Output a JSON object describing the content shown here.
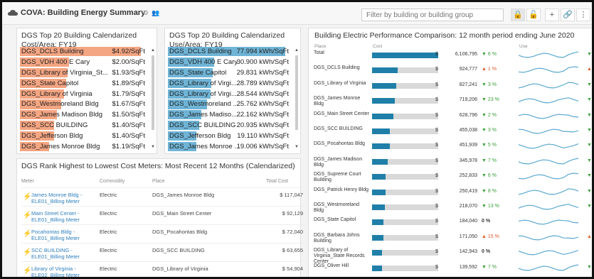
{
  "header": {
    "title": "COVA: Building Energy Summary",
    "filter_placeholder": "Filter by building or building group",
    "buttons": [
      "lock-icon",
      "lock-open-icon",
      "plus-icon",
      "link-icon",
      "more-icon"
    ]
  },
  "cost_area": {
    "title_line1": "DGS Top 20 Building Calendarized",
    "title_line2": "Cost/Area: FY19",
    "bar_color": "#f4a582",
    "max": 4.92,
    "rows": [
      {
        "name": "DGS_DCLS Building",
        "value": 4.92,
        "label": "$4.92/SqFt"
      },
      {
        "name": "DGS_VDH 400 E Cary",
        "value": 2.0,
        "label": "$2.00/SqFt"
      },
      {
        "name": "DGS_Library of Virginia_St...",
        "value": 1.93,
        "label": "$1.93/SqFt"
      },
      {
        "name": "DGS_State Capitol",
        "value": 1.89,
        "label": "$1.89/SqFt"
      },
      {
        "name": "DGS_Library of Virginia",
        "value": 1.79,
        "label": "$1.79/SqFt"
      },
      {
        "name": "DGS_Westmoreland Bldg",
        "value": 1.67,
        "label": "$1.67/SqFt"
      },
      {
        "name": "DGS_James Madison Bldg",
        "value": 1.5,
        "label": "$1.50/SqFt"
      },
      {
        "name": "DGS_SCC BUILDING",
        "value": 1.4,
        "label": "$1.40/SqFt"
      },
      {
        "name": "DGS_Jefferson Bldg",
        "value": 1.4,
        "label": "$1.40/SqFt"
      },
      {
        "name": "DGS_James Monroe Bldg",
        "value": 1.19,
        "label": "$1.19/SqFt"
      }
    ]
  },
  "use_area": {
    "title_line1": "DGS Top 20 Building Calendarized",
    "title_line2": "Use/Area: FY19",
    "bar_color": "#6fb4d6",
    "max": 77.994,
    "rows": [
      {
        "name": "DGS_DCLS Building",
        "value": 77.994,
        "label": "77.994 kWh/SqFt"
      },
      {
        "name": "DGS_VDH 400 E Cary",
        "value": 30.9,
        "label": "30.900 kWh/SqFt"
      },
      {
        "name": "DGS_State Capitol",
        "value": 29.831,
        "label": "29.831 kWh/SqFt"
      },
      {
        "name": "DGS_Library of Virgi...",
        "value": 28.789,
        "label": "28.789 kWh/SqFt"
      },
      {
        "name": "DGS_Library of Virgi...",
        "value": 28.544,
        "label": "28.544 kWh/SqFt"
      },
      {
        "name": "DGS_Westmoreland ...",
        "value": 25.762,
        "label": "25.762 kWh/SqFt"
      },
      {
        "name": "DGS_James Madiso...",
        "value": 22.162,
        "label": "22.162 kWh/SqFt"
      },
      {
        "name": "DGS_SCC BUILDING",
        "value": 20.935,
        "label": "20.935 kWh/SqFt"
      },
      {
        "name": "DGS_Jefferson Bldg",
        "value": 19.11,
        "label": "19.110 kWh/SqFt"
      },
      {
        "name": "DGS_James Monroe ...",
        "value": 19.006,
        "label": "19.006 kWh/SqFt"
      }
    ]
  },
  "cost_meters": {
    "title": "DGS Rank Highest to Lowest Cost Meters: Most Recent 12 Months (Calendarized)",
    "columns": {
      "meter": "Meter",
      "commodity": "Commodity",
      "place": "Place",
      "total_cost": "Total Cost"
    },
    "rows": [
      {
        "meter": "James Monroe Bldg - ELE01_Billing Meter",
        "commodity": "Electric",
        "place": "DGS_James Monroe Bldg",
        "cost": "$ 117,047"
      },
      {
        "meter": "Main Street Center - ELE01_Billing Meter",
        "commodity": "Electric",
        "place": "DGS_Main Street Center",
        "cost": "$ 92,129"
      },
      {
        "meter": "Pocahontas Bldg - ELE01_Billing Meter",
        "commodity": "Electric",
        "place": "DGS_Pocahontas Bldg",
        "cost": "$ 72,040"
      },
      {
        "meter": "SCC BUILDING - ELE01_Billing Meter",
        "commodity": "Electric",
        "place": "DGS_SCC BUILDING",
        "cost": "$ 63,655"
      },
      {
        "meter": "Library of Virginia - ELE02_Billing Meter",
        "commodity": "Electric",
        "place": "DGS_Library of Virginia",
        "cost": "$ 54,904"
      }
    ]
  },
  "performance": {
    "title": "Building Electric Performance Comparison: 12 month period ending June 2020",
    "columns": {
      "place": "Place",
      "cost": "Cost",
      "use": "Use"
    },
    "bar_max": 6106795,
    "rows": [
      {
        "place": "Total",
        "value": 6106795,
        "display": "6,106,795",
        "dir": "down",
        "change": "6 %"
      },
      {
        "place": "DGS_DCLS Building",
        "value": 924777,
        "display": "924,777",
        "dir": "up",
        "change": "1 %"
      },
      {
        "place": "DGS_Library of Virginia",
        "value": 827241,
        "display": "827,241",
        "dir": "down",
        "change": "3 %"
      },
      {
        "place": "DGS_James Monroe Bldg",
        "value": 719206,
        "display": "719,206",
        "dir": "down",
        "change": "23 %"
      },
      {
        "place": "DGS_Main Street Center",
        "value": 628796,
        "display": "628,796",
        "dir": "down",
        "change": "2 %"
      },
      {
        "place": "DGS_SCC BUILDING",
        "value": 455038,
        "display": "455,038",
        "dir": "down",
        "change": "3 %"
      },
      {
        "place": "DGS_Pocahontas Bldg",
        "value": 451939,
        "display": "451,939",
        "dir": "down",
        "change": "5 %"
      },
      {
        "place": "DGS_James Madison Bldg",
        "value": 345978,
        "display": "345,978",
        "dir": "down",
        "change": "7 %"
      },
      {
        "place": "DGS_Supreme Court Building",
        "value": 252833,
        "display": "252,833",
        "dir": "down",
        "change": "6 %"
      },
      {
        "place": "DGS_Patrick Henry Bldg",
        "value": 250419,
        "display": "250,419",
        "dir": "down",
        "change": "8 %"
      },
      {
        "place": "DGS_Westmoreland Bldg",
        "value": 218070,
        "display": "218,070",
        "dir": "down",
        "change": "13 %"
      },
      {
        "place": "DGS_State Capitol",
        "value": 184040,
        "display": "184,040",
        "dir": "flat",
        "change": "0 %"
      },
      {
        "place": "DGS_Barbara Johns Building",
        "value": 171050,
        "display": "171,050",
        "dir": "up",
        "change": "15 %"
      },
      {
        "place": "DGS_Library of Virginia_State Records Center",
        "value": 142943,
        "display": "142,943",
        "dir": "flat",
        "change": "0 %"
      },
      {
        "place": "DGS_Oliver Hill",
        "value": 139592,
        "display": "139,592",
        "dir": "down",
        "change": "7 %"
      }
    ]
  }
}
